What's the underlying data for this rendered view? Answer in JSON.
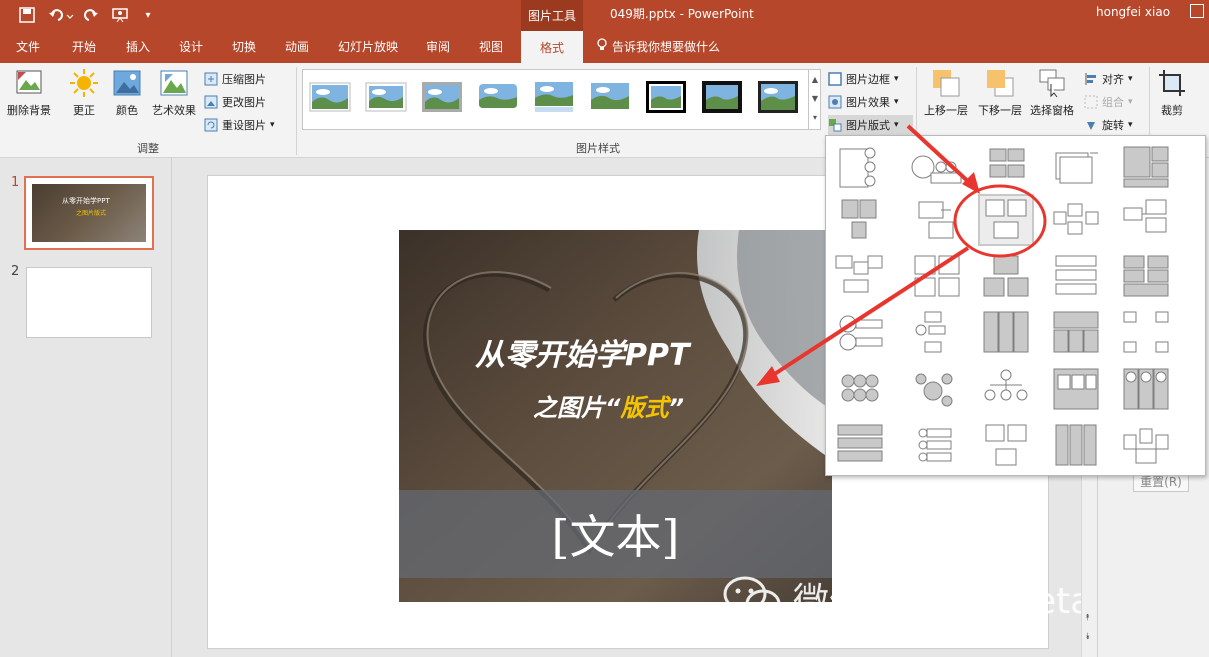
{
  "titlebar": {
    "context_tools": "图片工具",
    "doc_title": "049期.pptx - PowerPoint",
    "user": "hongfei xiao"
  },
  "tabs": [
    "文件",
    "开始",
    "插入",
    "设计",
    "切换",
    "动画",
    "幻灯片放映",
    "审阅",
    "视图",
    "格式"
  ],
  "active_tab": "格式",
  "tell_me": "告诉我你想要做什么",
  "ribbon": {
    "remove_bg": "删除背景",
    "corrections": "更正",
    "color": "颜色",
    "artistic": "艺术效果",
    "compress": "压缩图片",
    "change": "更改图片",
    "reset": "重设图片",
    "adjust_group": "调整",
    "styles_group": "图片样式",
    "border": "图片边框",
    "effects": "图片效果",
    "layout": "图片版式",
    "bring_forward": "上移一层",
    "send_backward": "下移一层",
    "selection_pane": "选择窗格",
    "align": "对齐",
    "group": "组合",
    "rotate": "旋转",
    "crop": "裁剪"
  },
  "thumbnails": [
    {
      "num": "1",
      "title": "从零开始学PPT",
      "sub": "之图片版式"
    },
    {
      "num": "2"
    }
  ],
  "slide": {
    "title": "从零开始学PPT",
    "subtitle_pre": "之图片“",
    "subtitle_hl": "版式",
    "subtitle_post": "”",
    "text_placeholder": "[文本]"
  },
  "right_panel": {
    "reset": "重置(R)"
  },
  "watermark": "微信号: feigeketang",
  "colors": {
    "accent": "#b7472a",
    "highlight": "#f5c400",
    "annotation": "#e8362e"
  }
}
